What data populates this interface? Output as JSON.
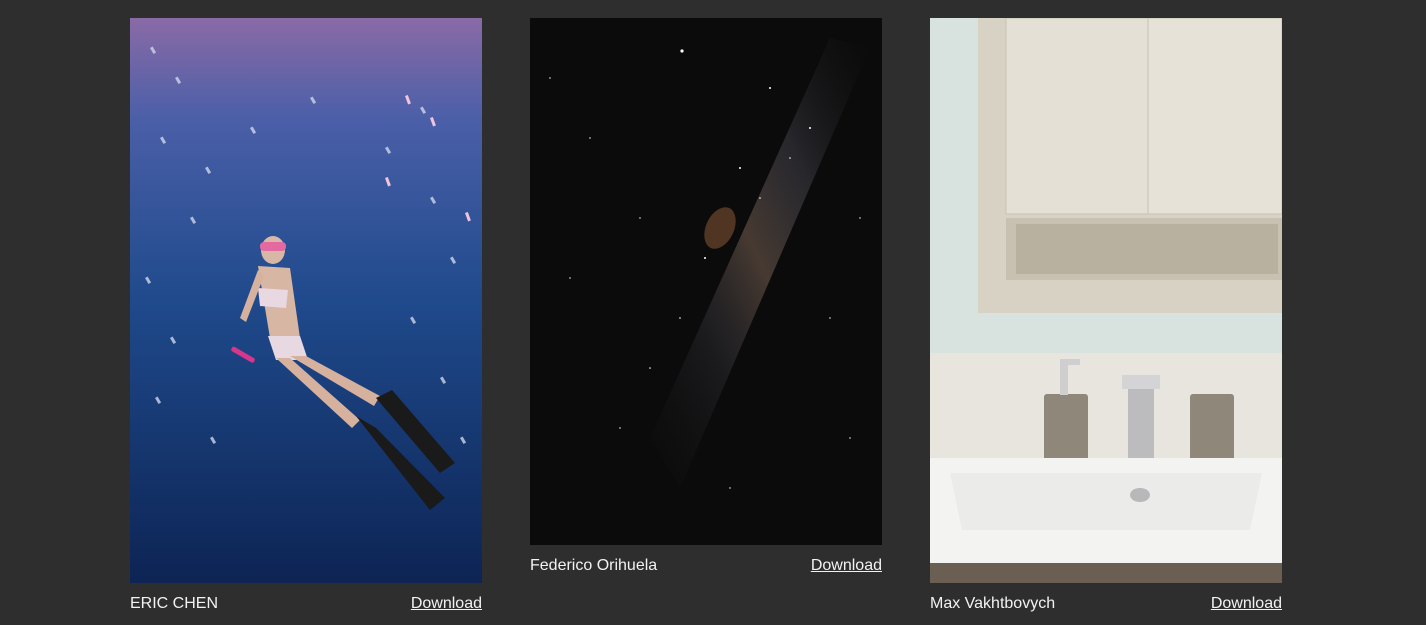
{
  "photos": [
    {
      "author": "ERIC CHEN",
      "download_label": "Download",
      "image_subject": "underwater-freediver-photo"
    },
    {
      "author": "Federico Orihuela",
      "download_label": "Download",
      "image_subject": "milky-way-night-sky-photo"
    },
    {
      "author": "Max Vakhtbovych",
      "download_label": "Download",
      "image_subject": "bathroom-sink-cabinet-photo"
    }
  ],
  "colors": {
    "background": "#2e2e2e",
    "text": "#f2f2f2"
  }
}
